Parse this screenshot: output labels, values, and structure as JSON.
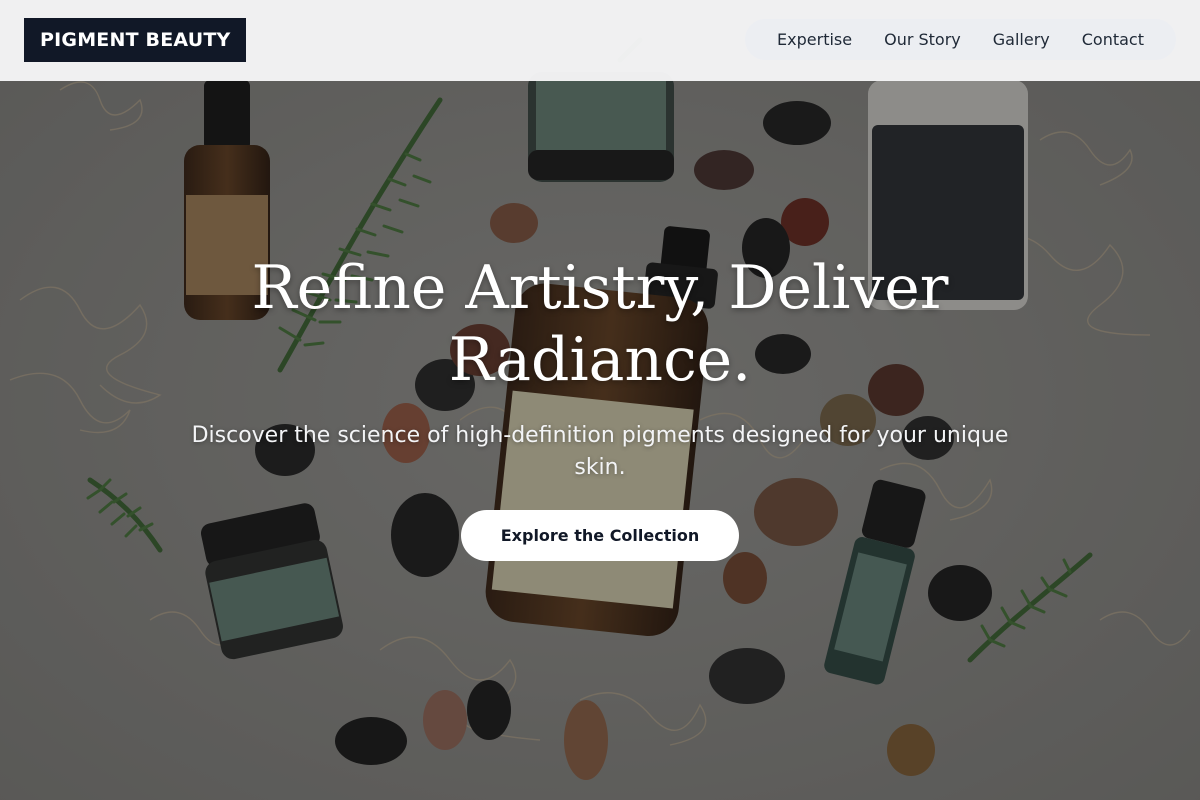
{
  "header": {
    "logo": "PIGMENT BEAUTY",
    "nav": [
      "Expertise",
      "Our Story",
      "Gallery",
      "Contact"
    ]
  },
  "hero": {
    "title": "Refine Artistry, Deliver Radiance.",
    "subtitle": "Discover the science of high-definition pigments designed for your unique skin.",
    "cta_label": "Explore the Collection",
    "background": "flat-lay photo of skincare bottles and jars with river stones, cedar sprigs and dried moss on grey stone"
  },
  "colors": {
    "header_bg": "#f5f5f6",
    "logo_bg": "#111827",
    "logo_text": "#ffffff",
    "nav_pill_bg": "#eceef2",
    "nav_text": "#1f2937",
    "hero_text": "#ffffff",
    "cta_bg": "#ffffff",
    "cta_text": "#111827"
  }
}
